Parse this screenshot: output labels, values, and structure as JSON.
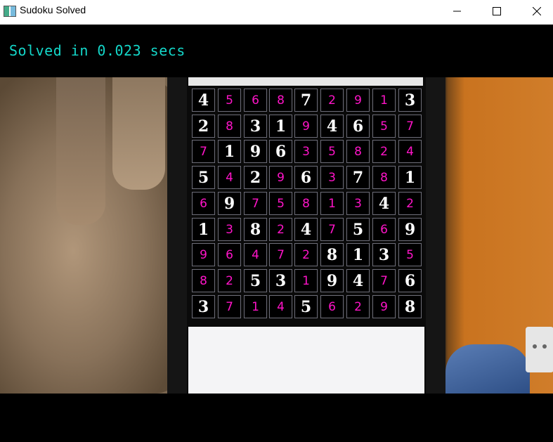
{
  "window": {
    "title": "Sudoku Solved"
  },
  "status": {
    "text": "Solved in 0.023 secs",
    "color": "#14d7c9"
  },
  "sudoku": {
    "given_color": "#ffffff",
    "solved_color": "#ff14c8",
    "rows": [
      [
        {
          "v": "4",
          "g": 1
        },
        {
          "v": "5",
          "g": 0
        },
        {
          "v": "6",
          "g": 0
        },
        {
          "v": "8",
          "g": 0
        },
        {
          "v": "7",
          "g": 1
        },
        {
          "v": "2",
          "g": 0
        },
        {
          "v": "9",
          "g": 0
        },
        {
          "v": "1",
          "g": 0
        },
        {
          "v": "3",
          "g": 1
        }
      ],
      [
        {
          "v": "2",
          "g": 1
        },
        {
          "v": "8",
          "g": 0
        },
        {
          "v": "3",
          "g": 1
        },
        {
          "v": "1",
          "g": 1
        },
        {
          "v": "9",
          "g": 0
        },
        {
          "v": "4",
          "g": 1
        },
        {
          "v": "6",
          "g": 1
        },
        {
          "v": "5",
          "g": 0
        },
        {
          "v": "7",
          "g": 0
        }
      ],
      [
        {
          "v": "7",
          "g": 0
        },
        {
          "v": "1",
          "g": 1
        },
        {
          "v": "9",
          "g": 1
        },
        {
          "v": "6",
          "g": 1
        },
        {
          "v": "3",
          "g": 0
        },
        {
          "v": "5",
          "g": 0
        },
        {
          "v": "8",
          "g": 0
        },
        {
          "v": "2",
          "g": 0
        },
        {
          "v": "4",
          "g": 0
        }
      ],
      [
        {
          "v": "5",
          "g": 1
        },
        {
          "v": "4",
          "g": 0
        },
        {
          "v": "2",
          "g": 1
        },
        {
          "v": "9",
          "g": 0
        },
        {
          "v": "6",
          "g": 1
        },
        {
          "v": "3",
          "g": 0
        },
        {
          "v": "7",
          "g": 1
        },
        {
          "v": "8",
          "g": 0
        },
        {
          "v": "1",
          "g": 1
        }
      ],
      [
        {
          "v": "6",
          "g": 0
        },
        {
          "v": "9",
          "g": 1
        },
        {
          "v": "7",
          "g": 0
        },
        {
          "v": "5",
          "g": 0
        },
        {
          "v": "8",
          "g": 0
        },
        {
          "v": "1",
          "g": 0
        },
        {
          "v": "3",
          "g": 0
        },
        {
          "v": "4",
          "g": 1
        },
        {
          "v": "2",
          "g": 0
        }
      ],
      [
        {
          "v": "1",
          "g": 1
        },
        {
          "v": "3",
          "g": 0
        },
        {
          "v": "8",
          "g": 1
        },
        {
          "v": "2",
          "g": 0
        },
        {
          "v": "4",
          "g": 1
        },
        {
          "v": "7",
          "g": 0
        },
        {
          "v": "5",
          "g": 1
        },
        {
          "v": "6",
          "g": 0
        },
        {
          "v": "9",
          "g": 1
        }
      ],
      [
        {
          "v": "9",
          "g": 0
        },
        {
          "v": "6",
          "g": 0
        },
        {
          "v": "4",
          "g": 0
        },
        {
          "v": "7",
          "g": 0
        },
        {
          "v": "2",
          "g": 0
        },
        {
          "v": "8",
          "g": 1
        },
        {
          "v": "1",
          "g": 1
        },
        {
          "v": "3",
          "g": 1
        },
        {
          "v": "5",
          "g": 0
        }
      ],
      [
        {
          "v": "8",
          "g": 0
        },
        {
          "v": "2",
          "g": 0
        },
        {
          "v": "5",
          "g": 1
        },
        {
          "v": "3",
          "g": 1
        },
        {
          "v": "1",
          "g": 0
        },
        {
          "v": "9",
          "g": 1
        },
        {
          "v": "4",
          "g": 1
        },
        {
          "v": "7",
          "g": 0
        },
        {
          "v": "6",
          "g": 1
        }
      ],
      [
        {
          "v": "3",
          "g": 1
        },
        {
          "v": "7",
          "g": 0
        },
        {
          "v": "1",
          "g": 0
        },
        {
          "v": "4",
          "g": 0
        },
        {
          "v": "5",
          "g": 1
        },
        {
          "v": "6",
          "g": 0
        },
        {
          "v": "2",
          "g": 0
        },
        {
          "v": "9",
          "g": 0
        },
        {
          "v": "8",
          "g": 1
        }
      ]
    ]
  },
  "icons": {
    "app": "app-window-icon",
    "minimize": "minimize-icon",
    "maximize": "maximize-icon",
    "close": "close-icon"
  }
}
